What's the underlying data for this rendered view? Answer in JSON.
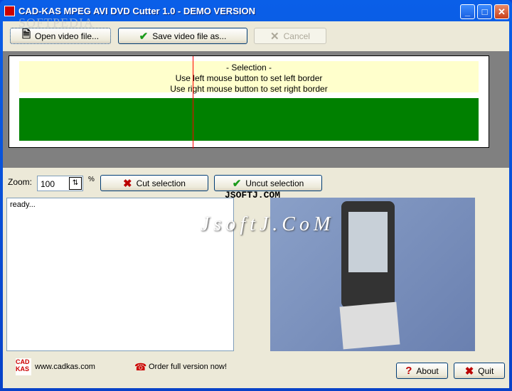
{
  "window": {
    "title": "CAD-KAS MPEG AVI DVD Cutter 1.0 - DEMO VERSION",
    "minimize": "_",
    "maximize": "□",
    "close": "✕"
  },
  "toolbar": {
    "open": "Open video file...",
    "save": "Save video file as...",
    "cancel": "Cancel"
  },
  "selection": {
    "title": "- Selection -",
    "line1": "Use left mouse button to set left border",
    "line2": "Use right mouse button to set right border"
  },
  "zoom": {
    "label": "Zoom:",
    "value": "100",
    "unit": "%"
  },
  "actions": {
    "cut": "Cut selection",
    "uncut": "Uncut selection"
  },
  "log": {
    "text": "ready..."
  },
  "footer": {
    "website": "www.cadkas.com",
    "order": "Order full version now!",
    "about": "About",
    "quit": "Quit"
  },
  "watermarks": {
    "w1": "SOFTPEDIA",
    "w2": "JSOFTJ.COM",
    "w3": "JsoftJ.CoM"
  },
  "colors": {
    "selection_bg": "#ffffcc",
    "track": "#008000",
    "marker": "#ff0000"
  }
}
